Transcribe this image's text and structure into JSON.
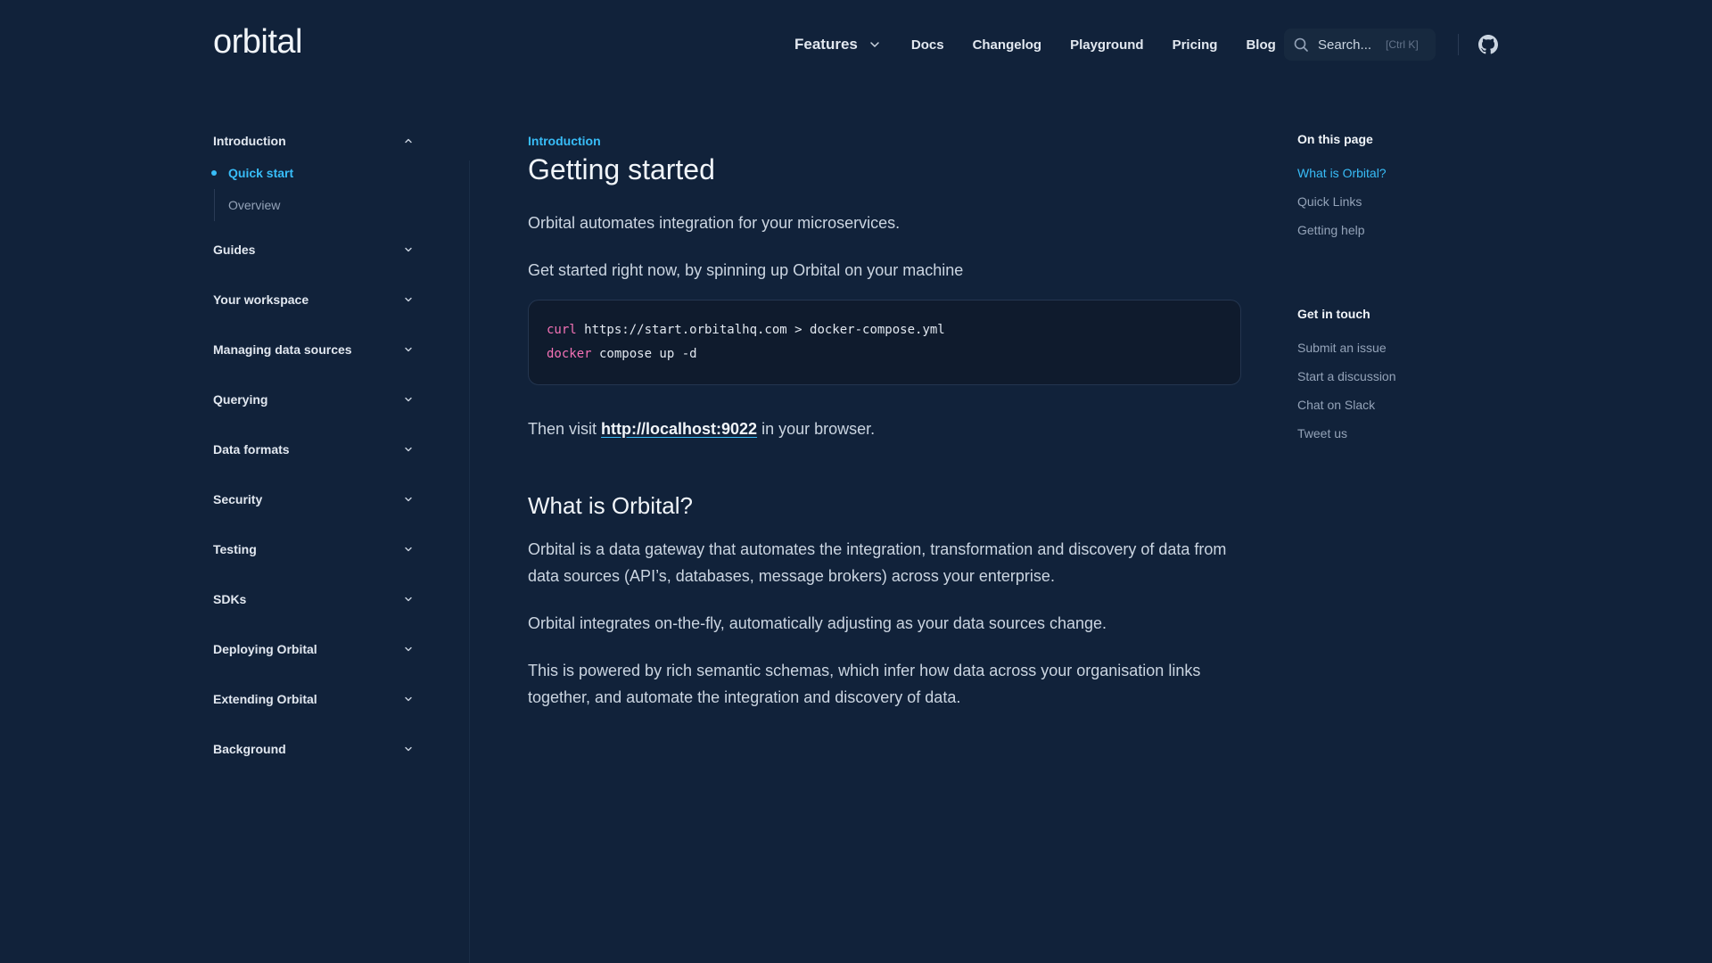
{
  "header": {
    "logo": "orbital",
    "nav": {
      "features": "Features",
      "docs": "Docs",
      "changelog": "Changelog",
      "playground": "Playground",
      "pricing": "Pricing",
      "blog": "Blog"
    },
    "search": {
      "placeholder": "Search...",
      "shortcut": "[Ctrl K]"
    },
    "github_icon": "github-icon"
  },
  "sidebar": {
    "sections": [
      {
        "title": "Introduction",
        "expanded": true,
        "items": [
          {
            "label": "Quick start",
            "active": true
          },
          {
            "label": "Overview",
            "active": false
          }
        ]
      },
      {
        "title": "Guides",
        "expanded": false
      },
      {
        "title": "Your workspace",
        "expanded": false
      },
      {
        "title": "Managing data sources",
        "expanded": false
      },
      {
        "title": "Querying",
        "expanded": false
      },
      {
        "title": "Data formats",
        "expanded": false
      },
      {
        "title": "Security",
        "expanded": false
      },
      {
        "title": "Testing",
        "expanded": false
      },
      {
        "title": "SDKs",
        "expanded": false
      },
      {
        "title": "Deploying Orbital",
        "expanded": false
      },
      {
        "title": "Extending Orbital",
        "expanded": false
      },
      {
        "title": "Background",
        "expanded": false
      }
    ]
  },
  "main": {
    "eyebrow": "Introduction",
    "title": "Getting started",
    "intro": "Orbital automates integration for your microservices.",
    "get_started": "Get started right now, by spinning up Orbital on your machine",
    "code": {
      "line1_cmd": "curl",
      "line1_rest": " https://start.orbitalhq.com > docker-compose.yml",
      "line2_cmd": "docker",
      "line2_rest": " compose up -d"
    },
    "visit_prefix": "Then visit ",
    "visit_link": "http://localhost:9022",
    "visit_suffix": " in your browser.",
    "what_is_title": "What is Orbital?",
    "what_is_p1": "Orbital is a data gateway that automates the integration, transformation and discovery of data from data sources (API’s, databases, message brokers) across your enterprise.",
    "what_is_p2": "Orbital integrates on-the-fly, automatically adjusting as your data sources change.",
    "what_is_p3": "This is powered by rich semantic schemas, which infer how data across your organisation links together, and automate the integration and discovery of data."
  },
  "toc": {
    "on_this_page": "On this page",
    "items": [
      "What is Orbital?",
      "Quick Links",
      "Getting help"
    ],
    "get_in_touch": "Get in touch",
    "contact": [
      "Submit an issue",
      "Start a discussion",
      "Chat on Slack",
      "Tweet us"
    ]
  },
  "colors": {
    "background": "#11223a",
    "accent": "#38bdf8",
    "code_keyword": "#f472b6"
  }
}
